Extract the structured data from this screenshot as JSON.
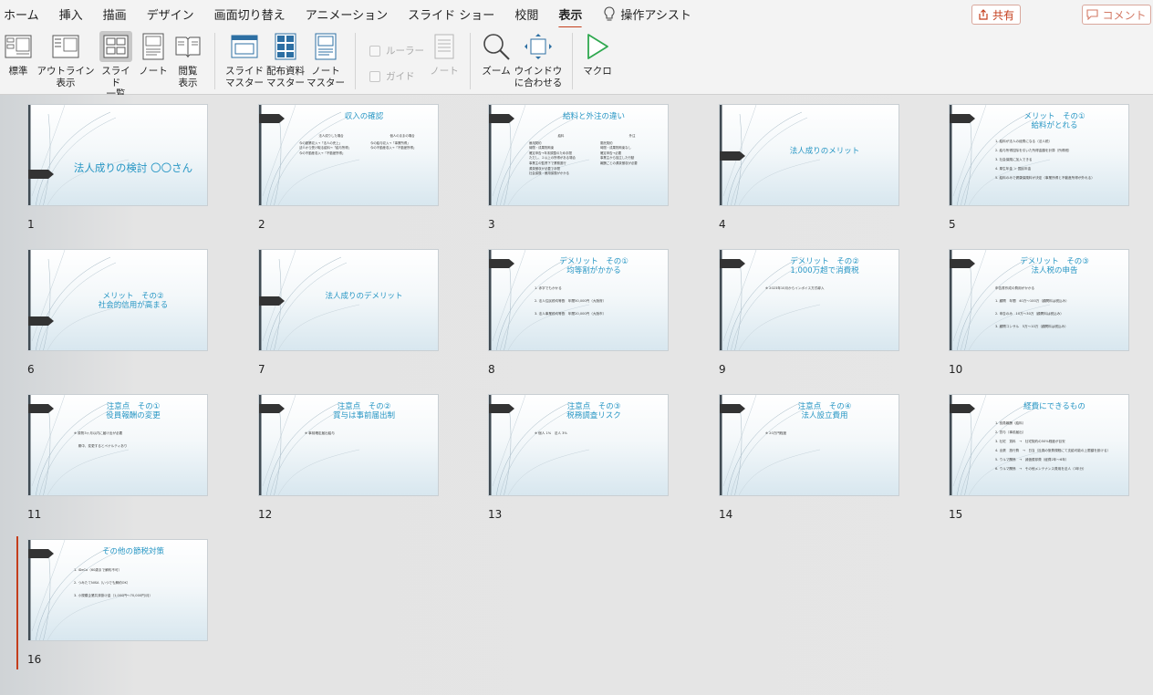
{
  "menu": [
    {
      "label": "ホーム",
      "active": false
    },
    {
      "label": "挿入",
      "active": false
    },
    {
      "label": "描画",
      "active": false
    },
    {
      "label": "デザイン",
      "active": false
    },
    {
      "label": "画面切り替え",
      "active": false
    },
    {
      "label": "アニメーション",
      "active": false
    },
    {
      "label": "スライド ショー",
      "active": false
    },
    {
      "label": "校閲",
      "active": false
    },
    {
      "label": "表示",
      "active": true
    }
  ],
  "assist_label": "操作アシスト",
  "share_label": "共有",
  "comment_label": "コメント",
  "accent_color": "#c43e1c",
  "title_color": "#2796c4",
  "ribbon": {
    "normal": [
      "標準"
    ],
    "outline": [
      "アウトライン",
      "表示"
    ],
    "sorter": [
      "スライド",
      "一覧"
    ],
    "notes_page": [
      "ノート"
    ],
    "reading": [
      "閲覧",
      "表示"
    ],
    "slide_master": [
      "スライド",
      "マスター"
    ],
    "handout_master": [
      "配布資料",
      "マスター"
    ],
    "notes_master": [
      "ノート",
      "マスター"
    ],
    "ruler": "ルーラー",
    "guides": "ガイド",
    "notes": "ノート",
    "zoom": "ズーム",
    "fit_window": [
      "ウインドウ",
      "に合わせる"
    ],
    "macro": "マクロ"
  },
  "slides": [
    {
      "num": "1",
      "title": [
        "法人成りの検討 〇〇さん"
      ],
      "layout": "title"
    },
    {
      "num": "2",
      "title": [
        "収入の確認"
      ],
      "layout": "cols",
      "left_head": "法人成りした場合",
      "right_head": "個人のままの場合",
      "left": [
        "今の副業収入→「法人の売上」",
        "法人から受け取る給料→「給与所得」",
        "今の不動産収入→「不動産所得」"
      ],
      "right": [
        "今の給与収入→「事業所得」",
        "今の不動産収入→「不動産所得」"
      ]
    },
    {
      "num": "3",
      "title": [
        "給料と外注の違い"
      ],
      "layout": "cols",
      "left_head": "給料",
      "right_head": "外注",
      "left": [
        "雇用契約",
        "時間・成果物拘束",
        "確定申告→年末調整のため手間",
        "ただし、２以上の所得がある場合",
        "事業主の監督下で業務遂行",
        "源泉徴収が必要で手間",
        "社会保険・雇用保険がかかる"
      ],
      "right": [
        "委託契約",
        "時間・成果物拘束なし",
        "確定申告→必要",
        "事業主から独立した行動",
        "報酬ごとの源泉徴収が必要"
      ]
    },
    {
      "num": "4",
      "title": [
        "法人成りのメリット"
      ],
      "layout": "center"
    },
    {
      "num": "5",
      "title": [
        "メリット　その①",
        "給料がとれる"
      ],
      "layout": "list",
      "body": [
        "1. 給料が法人の経費になる（法人税）",
        "2. 給与所得控除を引いた所得金額を計算（所得税）",
        "3. 社会保険に加入できる",
        "4. 厚生年金 ＞ 国民年金",
        "5. 給料のみで健康保険料が決定（事業所得と不動産所得が外れる）"
      ]
    },
    {
      "num": "6",
      "title": [
        "メリット　その②",
        "社会的信用が高まる"
      ],
      "layout": "center"
    },
    {
      "num": "7",
      "title": [
        "法人成りのデメリット"
      ],
      "layout": "center"
    },
    {
      "num": "8",
      "title": [
        "デメリット　その①",
        "均等割がかかる"
      ],
      "layout": "list",
      "body": [
        "1. 赤字でもかかる",
        "2. 法人住民税均等割　年間50,000円（大阪府）",
        "3. 法人事業税均等割　年間20,000円（大阪市）"
      ]
    },
    {
      "num": "9",
      "title": [
        "デメリット　その②",
        "1,000万超で消費税"
      ],
      "layout": "list",
      "body": [
        "※ 2023年10月からインボイス方式導入"
      ]
    },
    {
      "num": "10",
      "title": [
        "デメリット　その③",
        "法人税の申告"
      ],
      "layout": "list",
      "body": [
        "申告書作成の費用がかかる",
        "1. 顧問　年間　40万〜100万（顧問料は税込み）",
        "2. 申告のみ　10万〜30万（顧問料は税込み）",
        "3. 顧問コンサル　5万〜10万（顧問料は税込み）"
      ]
    },
    {
      "num": "11",
      "title": [
        "注意点　その①",
        "役員報酬の変更"
      ],
      "layout": "list",
      "body": [
        "※ 原則3ヶ月以内に届け出が必要",
        "　 期中、変更するとペナルティあり"
      ]
    },
    {
      "num": "12",
      "title": [
        "注意点　その②",
        "賞与は事前届出制"
      ],
      "layout": "list",
      "body": [
        "※ 事前確定届出給与"
      ]
    },
    {
      "num": "13",
      "title": [
        "注意点　その③",
        "税務調査リスク"
      ],
      "layout": "list",
      "body": [
        "※ 個人 1%　法人 3%"
      ]
    },
    {
      "num": "14",
      "title": [
        "注意点　その④",
        "法人設立費用"
      ],
      "layout": "list",
      "body": [
        "※ 20万円程度"
      ]
    },
    {
      "num": "15",
      "title": [
        "経費にできるもの"
      ],
      "layout": "list",
      "body": [
        "1. 役員報酬（給料）",
        "2. 賞与（事前届出）",
        "3. 社宅　賃料　→　社宅契約の50%程度が目安",
        "4. 出張　旅行費　→　日当（社員の旅費規程にて支給可能の上限額を設ける）",
        "5. ウルマ関係　→　減価償却費（経費2年〜6年）",
        "6. ウルマ関係　→　その他メンテナンス費用を法人（3年分）"
      ]
    },
    {
      "num": "16",
      "title": [
        "その他の節税対策"
      ],
      "layout": "list",
      "body": [
        "1. iDeCo（60歳まで解約不可）",
        "2. つみたてNISA（いつでも解約OK）",
        "3. 小規模企業共済掛け金（1,000円〜70,000円/月）"
      ]
    }
  ]
}
